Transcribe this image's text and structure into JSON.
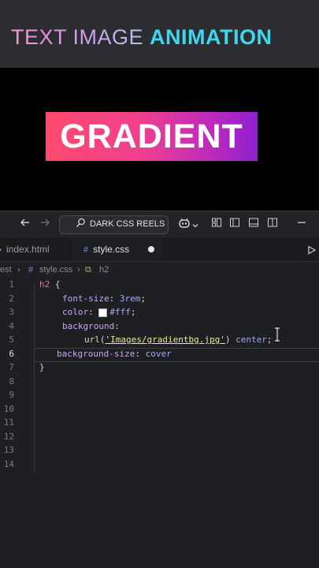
{
  "banner": {
    "part1": "TEXT IMAGE ",
    "part2": "ANIMATION"
  },
  "preview": {
    "heading": "GRADIENT"
  },
  "toolbar": {
    "search_text": "DARK CSS REELS",
    "icons": [
      "back-arrow-icon",
      "forward-arrow-icon",
      "search-icon",
      "copilot-icon",
      "chevron-down-icon",
      "layout-icon",
      "sidebar-left-icon",
      "panel-bottom-icon",
      "sidebar-right-icon",
      "minimize-icon"
    ]
  },
  "tabs": [
    {
      "label": "index.html",
      "active": false
    },
    {
      "label": "style.css",
      "active": true,
      "modified": true
    }
  ],
  "breadcrumb": {
    "folder": "est",
    "file": "style.css",
    "symbol": "h2"
  },
  "editor": {
    "line_numbers": [
      "1",
      "2",
      "3",
      "4",
      "5",
      "6",
      "7",
      "8",
      "9",
      "10",
      "11",
      "12",
      "13",
      "14"
    ],
    "current_line": "6",
    "lines": {
      "l1_sel": "h2",
      "l1_brace": " {",
      "l2_prop": "font-size",
      "l2_val": "3rem",
      "l3_prop": "color",
      "l3_val": "#fff",
      "l4_prop": "background",
      "l5_fn": "url(",
      "l5_str": "'Images/gradientbg.jpg'",
      "l5_close": ")",
      "l5_val": "center",
      "l6_prop": "background-size",
      "l6_val": "cover",
      "l7_brace": "}"
    }
  }
}
